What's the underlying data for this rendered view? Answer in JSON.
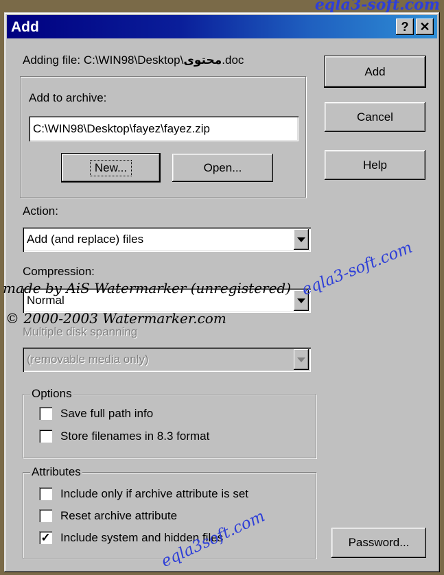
{
  "window": {
    "title": "Add",
    "help_button": "?",
    "close_button": "✕"
  },
  "adding_file": {
    "prefix": "Adding file: C:\\WIN98\\Desktop\\",
    "arabic_name": "محتوى",
    "suffix": ".doc"
  },
  "archive_group": {
    "label": "Add to archive:",
    "path_value": "C:\\WIN98\\Desktop\\fayez\\fayez.zip",
    "new_button": "New...",
    "open_button": "Open..."
  },
  "side_buttons": {
    "add": "Add",
    "cancel": "Cancel",
    "help": "Help",
    "password": "Password..."
  },
  "action": {
    "label": "Action:",
    "value": "Add (and replace) files"
  },
  "compression": {
    "label": "Compression:",
    "value": "Normal"
  },
  "disk_spanning": {
    "label": "Multiple disk spanning",
    "value": "(removable media only)"
  },
  "options": {
    "title": "Options",
    "items": [
      {
        "label": "Save full path info",
        "checked": false
      },
      {
        "label": "Store filenames in 8.3 format",
        "checked": false
      }
    ]
  },
  "attributes": {
    "title": "Attributes",
    "items": [
      {
        "label": "Include only if archive attribute is set",
        "checked": false
      },
      {
        "label": "Reset archive attribute",
        "checked": false
      },
      {
        "label": "Include system and hidden files",
        "checked": true
      }
    ]
  },
  "watermarks": {
    "top_right": "eqla3-soft.com",
    "made_by": "made by AiS Watermarker (unregistered)",
    "copyright": "© 2000-2003 Watermarker.com",
    "diag_middle": "eqla3-soft.com",
    "diag_bottom": "eqla3soft.com"
  },
  "colors": {
    "titlebar_start": "#000080",
    "titlebar_end": "#2f8fd6",
    "dialog_bg": "#c0c0c0",
    "watermark_blue": "#2e3fd8"
  }
}
